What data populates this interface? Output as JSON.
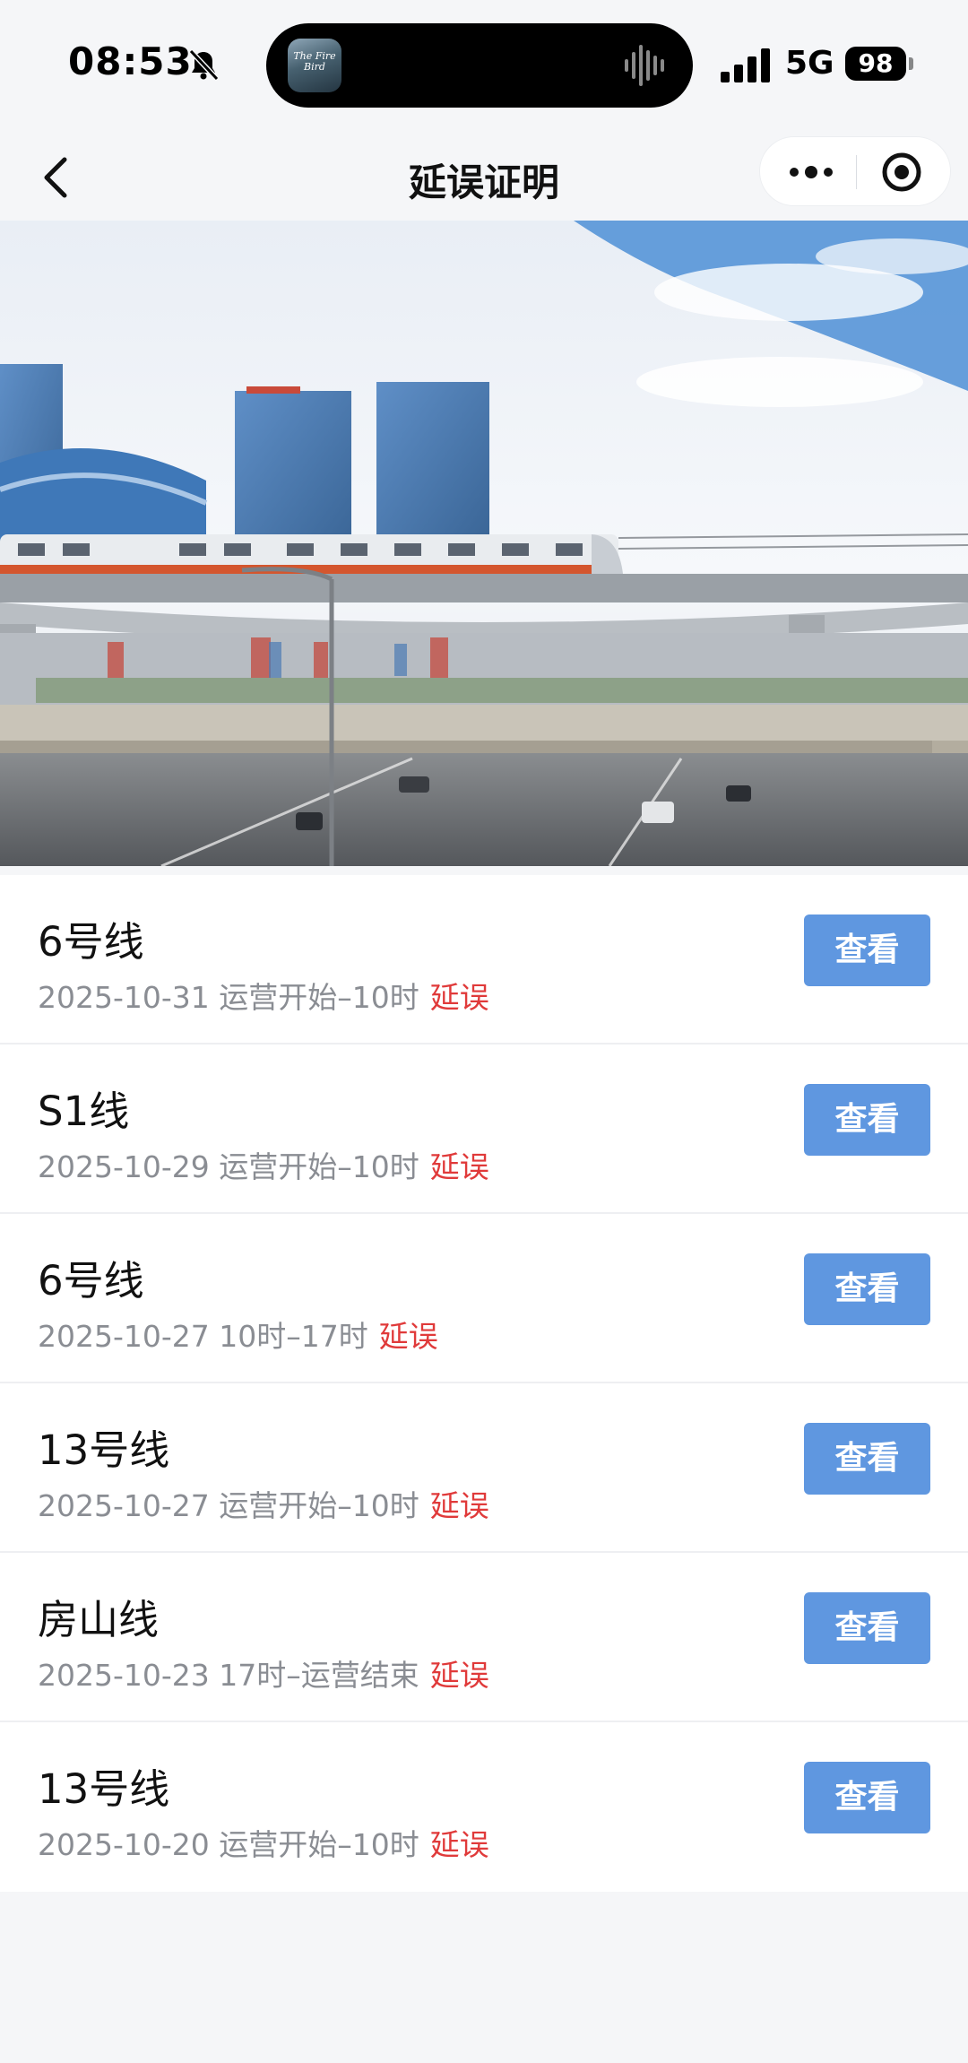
{
  "status_bar": {
    "time": "08:53",
    "network": "5G",
    "battery": "98",
    "island_app_label": "The Fire Bird",
    "icons": [
      "bell-muted-icon",
      "audio-wave-icon",
      "signal-bars-icon"
    ]
  },
  "nav": {
    "title": "延误证明",
    "icons": [
      "chevron-left-icon",
      "more-dots-icon",
      "target-circle-icon"
    ]
  },
  "records": [
    {
      "line": "6号线",
      "date": "2025-10-31",
      "period": "运营开始–10时",
      "status": "延误",
      "action": "查看"
    },
    {
      "line": "S1线",
      "date": "2025-10-29",
      "period": "运营开始–10时",
      "status": "延误",
      "action": "查看"
    },
    {
      "line": "6号线",
      "date": "2025-10-27",
      "period": "10时–17时",
      "status": "延误",
      "action": "查看"
    },
    {
      "line": "13号线",
      "date": "2025-10-27",
      "period": "运营开始–10时",
      "status": "延误",
      "action": "查看"
    },
    {
      "line": "房山线",
      "date": "2025-10-23",
      "period": "17时–运营结束",
      "status": "延误",
      "action": "查看"
    },
    {
      "line": "13号线",
      "date": "2025-10-20",
      "period": "运营开始–10时",
      "status": "延误",
      "action": "查看"
    }
  ],
  "colors": {
    "button": "#5f97e0",
    "delay_text": "#e03a3a",
    "secondary_text": "#8a8d93",
    "background": "#f5f6f8"
  }
}
